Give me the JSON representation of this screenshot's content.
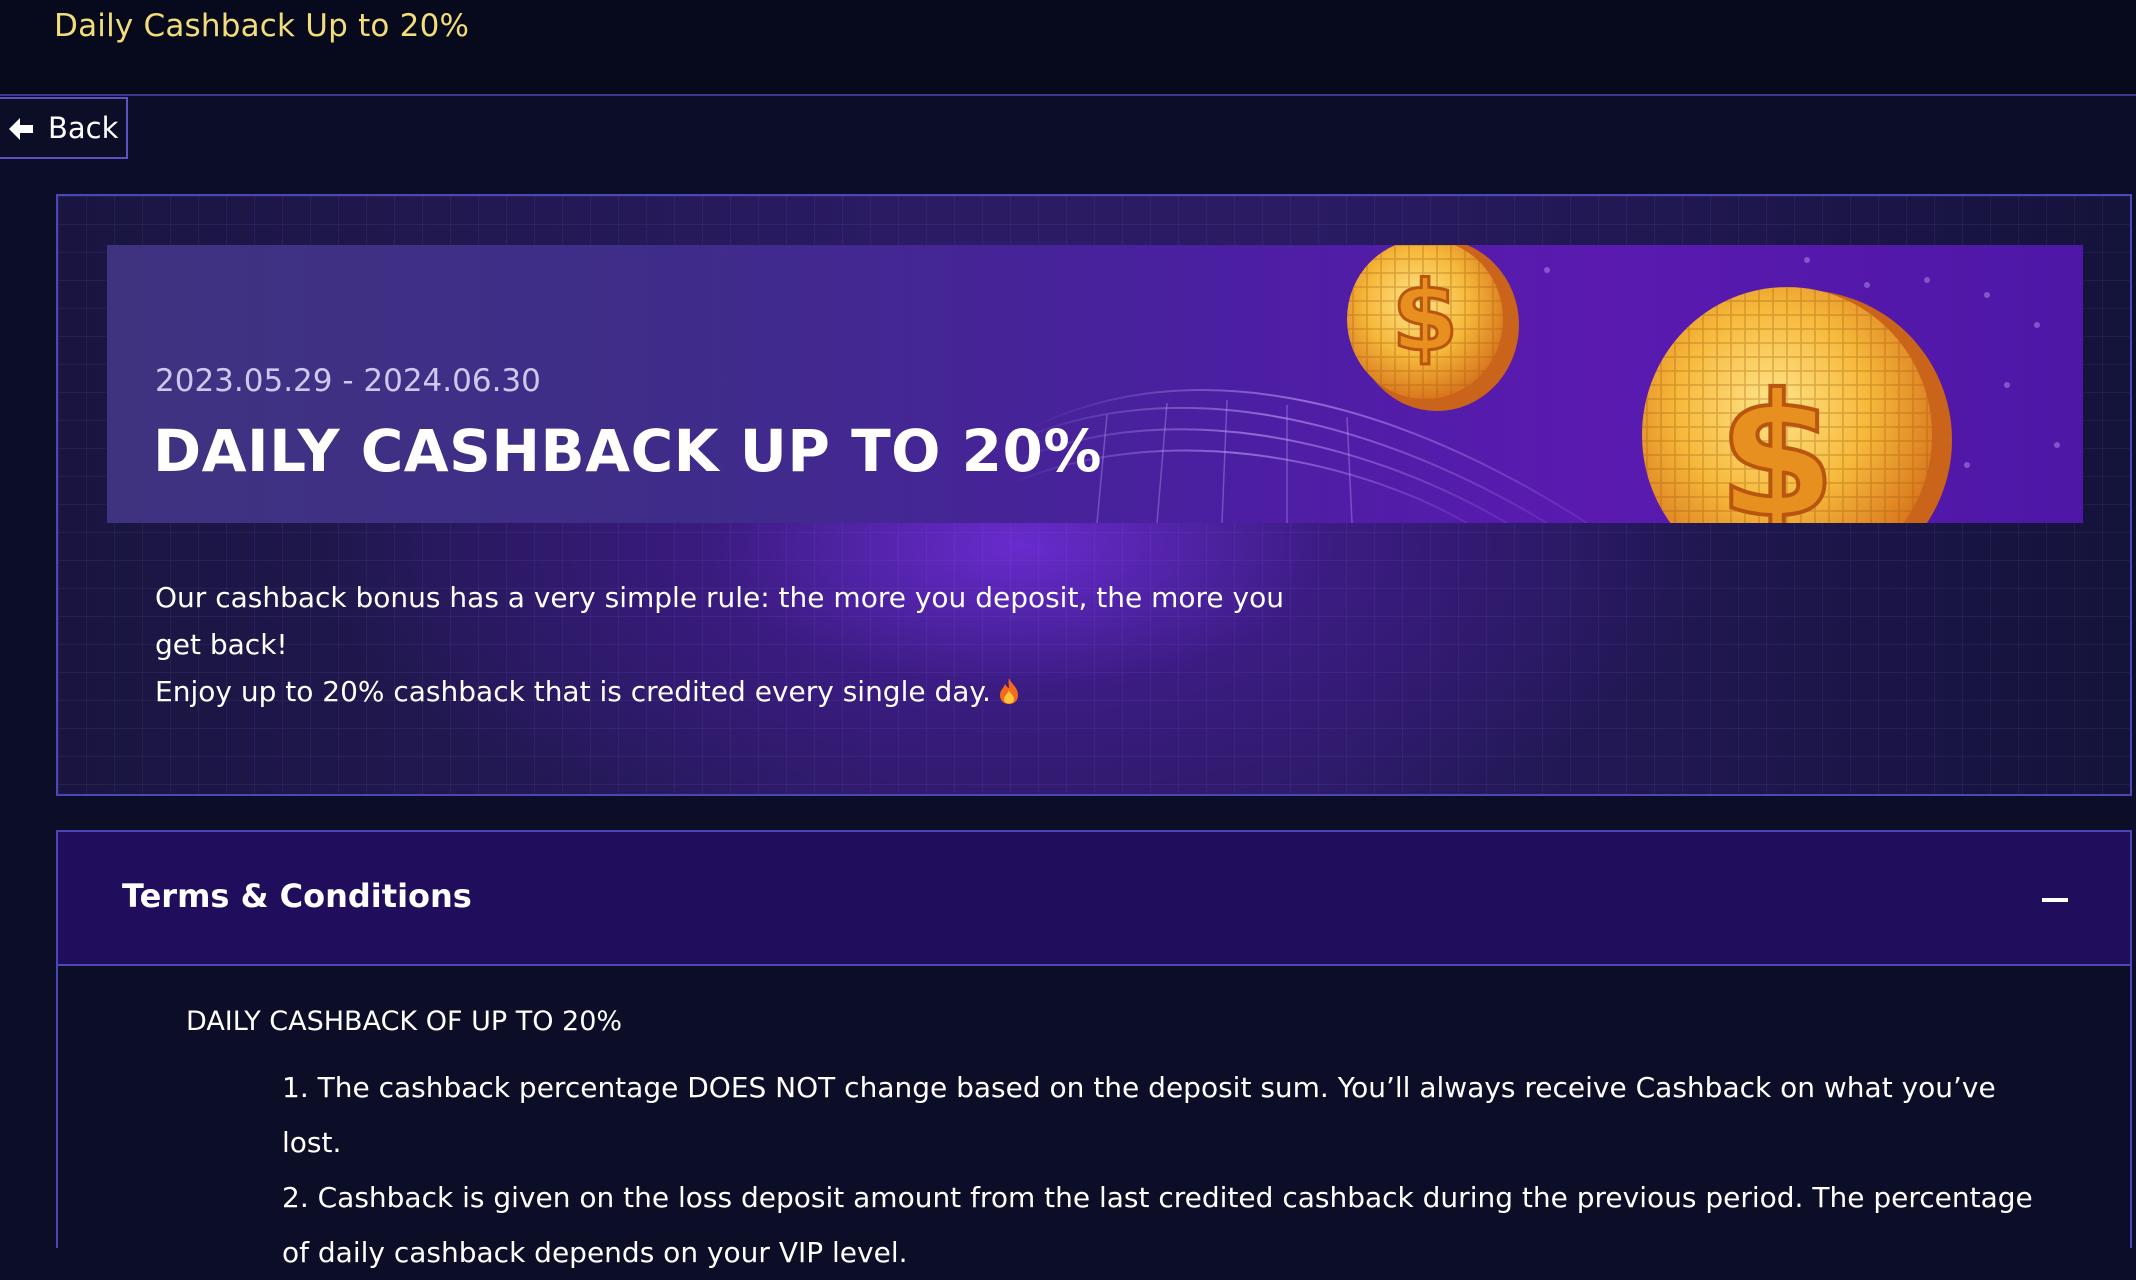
{
  "header": {
    "page_title": "Daily Cashback Up to 20%"
  },
  "nav": {
    "back_label": "Back",
    "back_icon": "arrow-left-icon"
  },
  "promo": {
    "date_range": "2023.05.29 - 2024.06.30",
    "title": "DAILY CASHBACK UP TO 20%",
    "description_line1": "Our cashback bonus has a very simple rule: the more you deposit, the more you get back!",
    "description_line2": "Enjoy up to 20% cashback that is credited every single day.",
    "description_icon": "fire-icon"
  },
  "terms": {
    "title": "Terms & Conditions",
    "expanded": true,
    "toggle_icon": "minus-icon",
    "heading": "DAILY CASHBACK OF UP TO 20%",
    "items": [
      "1. The cashback percentage DOES NOT change based on the deposit sum. You’ll always receive Cashback on what you’ve lost.",
      "2. Cashback is given on the loss deposit amount from the last credited cashback during the previous period. The percentage of daily cashback depends on your VIP level."
    ]
  },
  "colors": {
    "background": "#0b0e26",
    "accent_title": "#f2dd7a",
    "border": "#4c47b8",
    "terms_header": "#200d5c",
    "promo_purple": "#6c2cd4",
    "coin": "#f2a531"
  }
}
